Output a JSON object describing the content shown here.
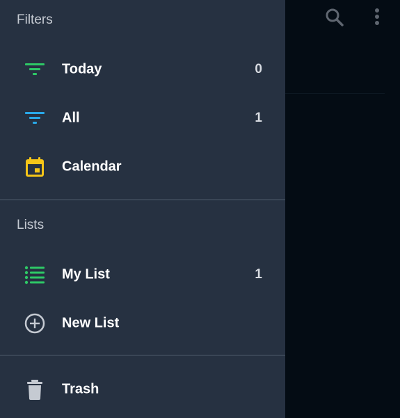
{
  "filters": {
    "title": "Filters",
    "items": [
      {
        "label": "Today",
        "count": "0",
        "icon": "filter-icon",
        "color": "#2ec866"
      },
      {
        "label": "All",
        "count": "1",
        "icon": "filter-icon",
        "color": "#29a8e8"
      },
      {
        "label": "Calendar",
        "count": "",
        "icon": "calendar-icon",
        "color": "#f5c518"
      }
    ]
  },
  "lists": {
    "title": "Lists",
    "items": [
      {
        "label": "My List",
        "count": "1",
        "icon": "list-icon",
        "color": "#2ec866"
      },
      {
        "label": "New List",
        "icon": "add-circle-icon",
        "color": "#c5cad2"
      }
    ]
  },
  "trash": {
    "label": "Trash",
    "icon": "trash-icon",
    "color": "#c5cad2"
  },
  "toolbar": {
    "search_icon": "search-icon",
    "more_icon": "more-vert-icon"
  }
}
